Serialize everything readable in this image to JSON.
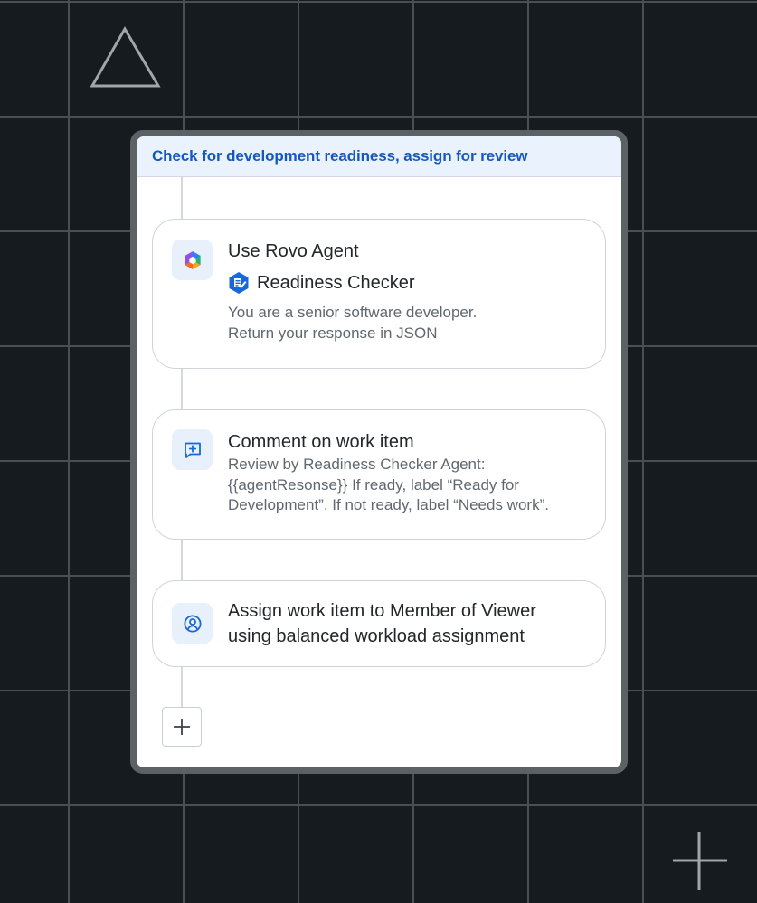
{
  "panel": {
    "title": "Check for development readiness, assign for review"
  },
  "steps": [
    {
      "icon": "rovo-icon",
      "title": "Use Rovo Agent",
      "agent_icon": "readiness-checker-icon",
      "agent_name": "Readiness Checker",
      "description_lines": [
        "You are a senior software developer.",
        "Return your response in JSON"
      ]
    },
    {
      "icon": "comment-add-icon",
      "title": "Comment on work item",
      "description_lines": [
        "Review by Readiness Checker Agent:",
        "{{agentResonse}} If ready, label “Ready for",
        "Development”. If not ready, label “Needs work”."
      ]
    },
    {
      "icon": "person-icon",
      "title_lines": [
        "Assign work item to Member of Viewer",
        "using balanced workload assignment"
      ]
    }
  ],
  "add_button": {
    "icon": "plus-icon"
  },
  "colors": {
    "background": "#151b1e",
    "grid_line": "#4a4f52",
    "panel_frame": "#5c6163",
    "header_bg": "#e9f2fd",
    "header_text": "#1558bc",
    "icon_tile": "#e8f0fb",
    "icon_blue": "#1868db"
  }
}
